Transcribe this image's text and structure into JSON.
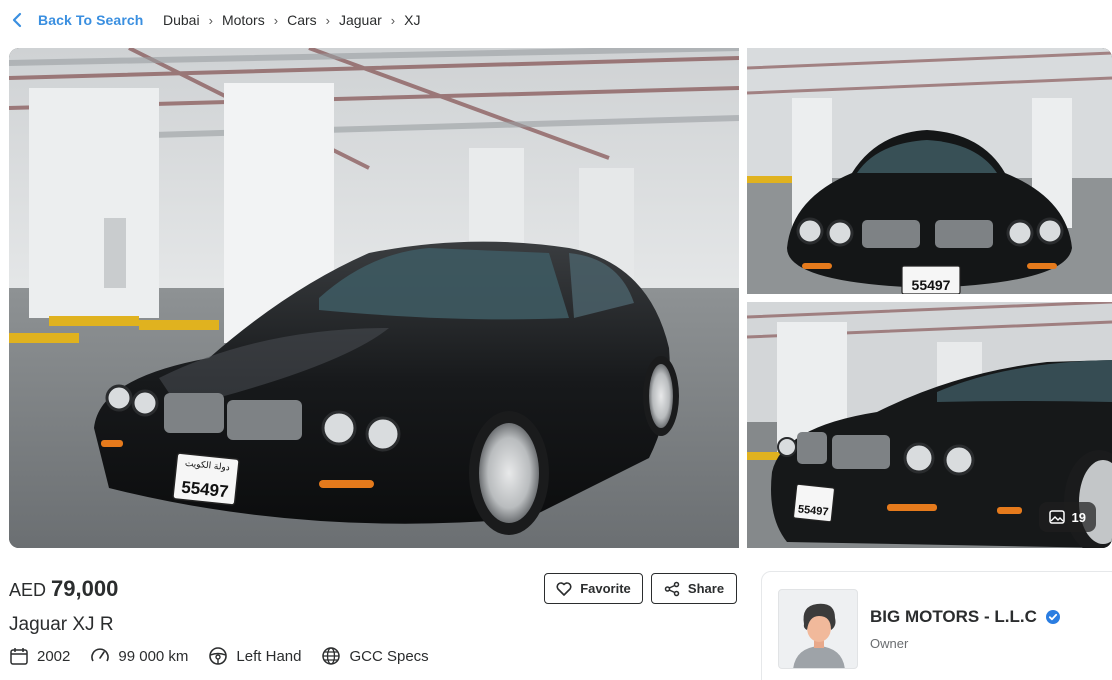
{
  "nav": {
    "back_label": "Back To Search",
    "breadcrumb": [
      "Dubai",
      "Motors",
      "Cars",
      "Jaguar",
      "XJ"
    ]
  },
  "gallery": {
    "photo_count": "19",
    "plate_text": "55497",
    "plate_small": "8",
    "plate_arabic": "دولة الكويت"
  },
  "listing": {
    "currency": "AED",
    "price": "79,000",
    "title": "Jaguar XJ R",
    "specs": {
      "year": "2002",
      "mileage": "99 000 km",
      "steering": "Left Hand",
      "region": "GCC Specs"
    }
  },
  "actions": {
    "favorite_label": "Favorite",
    "share_label": "Share"
  },
  "agent": {
    "name": "BIG MOTORS - L.L.C",
    "role": "Owner",
    "verified": true
  },
  "colors": {
    "accent": "#3a8fe0",
    "verified": "#2a7de1",
    "text": "#2b2d2e"
  }
}
